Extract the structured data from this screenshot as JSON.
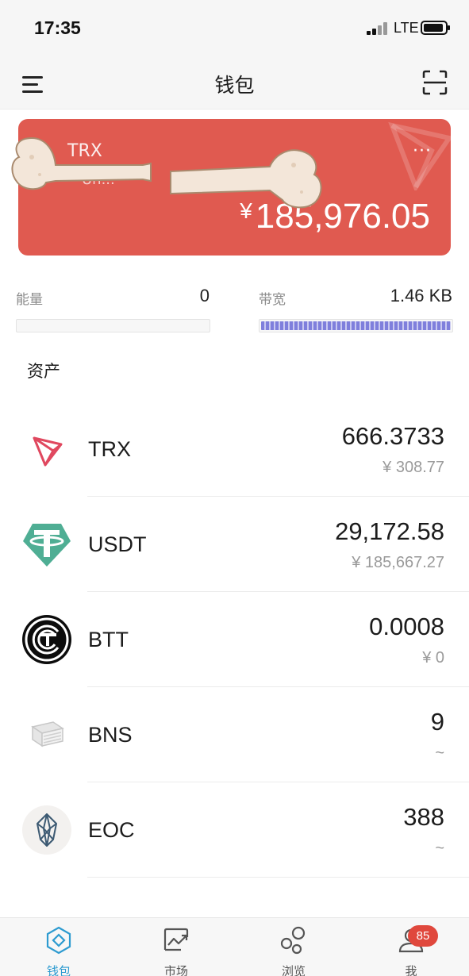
{
  "status_bar": {
    "time": "17:35",
    "network": "LTE"
  },
  "header": {
    "title": "钱包"
  },
  "wallet_card": {
    "name": "TRX",
    "address": "Uh...",
    "currency_symbol": "¥",
    "balance": "185,976.05",
    "more_label": "···",
    "color": "#e05a50"
  },
  "resources": {
    "energy": {
      "label": "能量",
      "value": "0",
      "fill": 0
    },
    "bandwidth": {
      "label": "带宽",
      "value": "1.46 KB",
      "fill": 1.0
    }
  },
  "assets_section": {
    "title": "资产"
  },
  "assets": [
    {
      "icon": "trx-icon",
      "symbol": "TRX",
      "amount": "666.3733",
      "fiat": "¥ 308.77"
    },
    {
      "icon": "usdt-icon",
      "symbol": "USDT",
      "amount": "29,172.58",
      "fiat": "¥ 185,667.27"
    },
    {
      "icon": "btt-icon",
      "symbol": "BTT",
      "amount": "0.0008",
      "fiat": "¥ 0"
    },
    {
      "icon": "bns-icon",
      "symbol": "BNS",
      "amount": "9",
      "fiat": "~"
    },
    {
      "icon": "eoc-icon",
      "symbol": "EOC",
      "amount": "388",
      "fiat": "~"
    }
  ],
  "tab_bar": {
    "tabs": [
      {
        "label": "钱包",
        "icon": "wallet-icon",
        "active": true
      },
      {
        "label": "市场",
        "icon": "market-chart-icon",
        "active": false
      },
      {
        "label": "浏览",
        "icon": "discover-icon",
        "active": false
      },
      {
        "label": "我",
        "icon": "profile-icon",
        "active": false
      }
    ],
    "badge": "85",
    "accent_color": "#2d9bd0"
  }
}
